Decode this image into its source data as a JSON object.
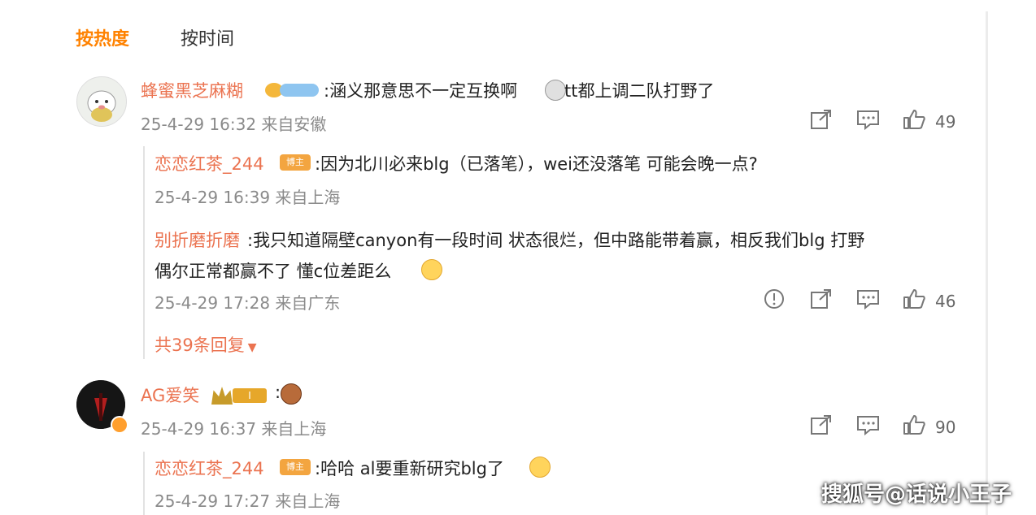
{
  "tabs": [
    {
      "label": "按热度",
      "active": true
    },
    {
      "label": "按时间",
      "active": false
    }
  ],
  "comments": [
    {
      "user": "蜂蜜黑芝麻糊",
      "text": ":涵义那意思不一定互换啊",
      "text_tail": "tt都上调二队打野了",
      "meta": "25-4-29 16:32 来自安徽",
      "likes": "49",
      "replies": [
        {
          "user": "恋恋红茶_244",
          "badge": "博主",
          "text": ":因为北川必来blg（已落笔），wei还没落笔 可能会晚一点?",
          "meta": "25-4-29 16:39 来自上海"
        },
        {
          "user": "别折磨折磨",
          "text_line1": ":我只知道隔壁canyon有一段时间 状态很烂，但中路能带着赢，相反我们blg 打野",
          "text_line2": "偶尔正常都赢不了 懂c位差距么",
          "meta": "25-4-29 17:28 来自广东",
          "likes": "46"
        }
      ],
      "more_replies": "共39条回复"
    },
    {
      "user": "AG爱笑",
      "badge_level": "I",
      "text": ":",
      "meta": "25-4-29 16:37 来自上海",
      "likes": "90",
      "replies": [
        {
          "user": "恋恋红茶_244",
          "badge": "博主",
          "text": ":哈哈 al要重新研究blg了",
          "meta": "25-4-29 17:27 来自上海"
        }
      ]
    }
  ],
  "watermark": "搜狐号@话说小王子",
  "colors": {
    "accent": "#ff8200",
    "username": "#eb7350",
    "meta": "#8a8a8a"
  }
}
